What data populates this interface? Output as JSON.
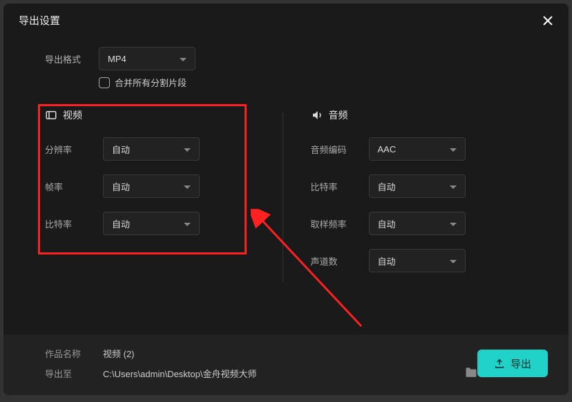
{
  "dialog": {
    "title": "导出设置"
  },
  "format": {
    "label": "导出格式",
    "value": "MP4",
    "merge_checkbox": "合并所有分割片段"
  },
  "video": {
    "section": "视频",
    "resolution_label": "分辨率",
    "resolution_value": "自动",
    "framerate_label": "帧率",
    "framerate_value": "自动",
    "bitrate_label": "比特率",
    "bitrate_value": "自动"
  },
  "audio": {
    "section": "音频",
    "codec_label": "音频编码",
    "codec_value": "AAC",
    "bitrate_label": "比特率",
    "bitrate_value": "自动",
    "samplerate_label": "取样频率",
    "samplerate_value": "自动",
    "channels_label": "声道数",
    "channels_value": "自动"
  },
  "footer": {
    "name_label": "作品名称",
    "name_value": "视频 (2)",
    "path_label": "导出至",
    "path_value": "C:\\Users\\admin\\Desktop\\金舟视频大师",
    "export_button": "导出"
  }
}
